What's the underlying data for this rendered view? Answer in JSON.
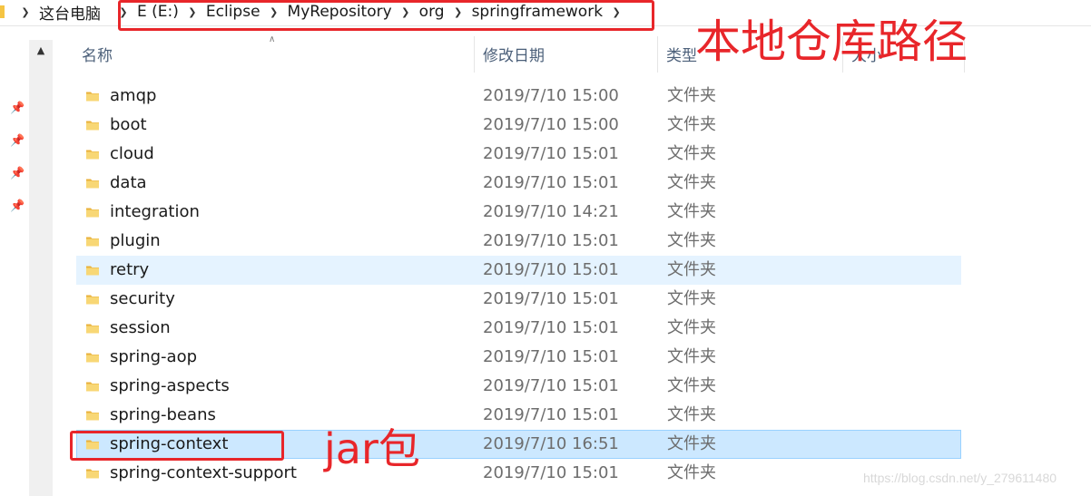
{
  "breadcrumb": [
    {
      "label": "这台电脑"
    },
    {
      "label": "E (E:)"
    },
    {
      "label": "Eclipse"
    },
    {
      "label": "MyRepository"
    },
    {
      "label": "org"
    },
    {
      "label": "springframework"
    }
  ],
  "columns": {
    "name": "名称",
    "date": "修改日期",
    "type": "类型",
    "size": "大小"
  },
  "files": [
    {
      "name": "amqp",
      "date": "2019/7/10 15:00",
      "type": "文件夹"
    },
    {
      "name": "boot",
      "date": "2019/7/10 15:00",
      "type": "文件夹"
    },
    {
      "name": "cloud",
      "date": "2019/7/10 15:01",
      "type": "文件夹"
    },
    {
      "name": "data",
      "date": "2019/7/10 15:01",
      "type": "文件夹"
    },
    {
      "name": "integration",
      "date": "2019/7/10 14:21",
      "type": "文件夹"
    },
    {
      "name": "plugin",
      "date": "2019/7/10 15:01",
      "type": "文件夹"
    },
    {
      "name": "retry",
      "date": "2019/7/10 15:01",
      "type": "文件夹",
      "state": "hover"
    },
    {
      "name": "security",
      "date": "2019/7/10 15:01",
      "type": "文件夹"
    },
    {
      "name": "session",
      "date": "2019/7/10 15:01",
      "type": "文件夹"
    },
    {
      "name": "spring-aop",
      "date": "2019/7/10 15:01",
      "type": "文件夹"
    },
    {
      "name": "spring-aspects",
      "date": "2019/7/10 15:01",
      "type": "文件夹"
    },
    {
      "name": "spring-beans",
      "date": "2019/7/10 15:01",
      "type": "文件夹"
    },
    {
      "name": "spring-context",
      "date": "2019/7/10 16:51",
      "type": "文件夹",
      "state": "selected"
    },
    {
      "name": "spring-context-support",
      "date": "2019/7/10 15:01",
      "type": "文件夹"
    }
  ],
  "annotations": {
    "path_label": "本地仓库路径",
    "jar_label": "jar包"
  },
  "watermark": "https://blog.csdn.net/y_279611480",
  "icons": {
    "folder": "folder-icon",
    "pin": "pin-icon",
    "chevron": "chevron-right-icon",
    "scroll_up": "scroll-up-icon",
    "sort": "sort-ascending-icon"
  },
  "colors": {
    "annotation_red": "#e8262a",
    "folder_yellow": "#f5c443",
    "hover_row": "#e5f3ff",
    "selected_row": "#cce8ff"
  }
}
